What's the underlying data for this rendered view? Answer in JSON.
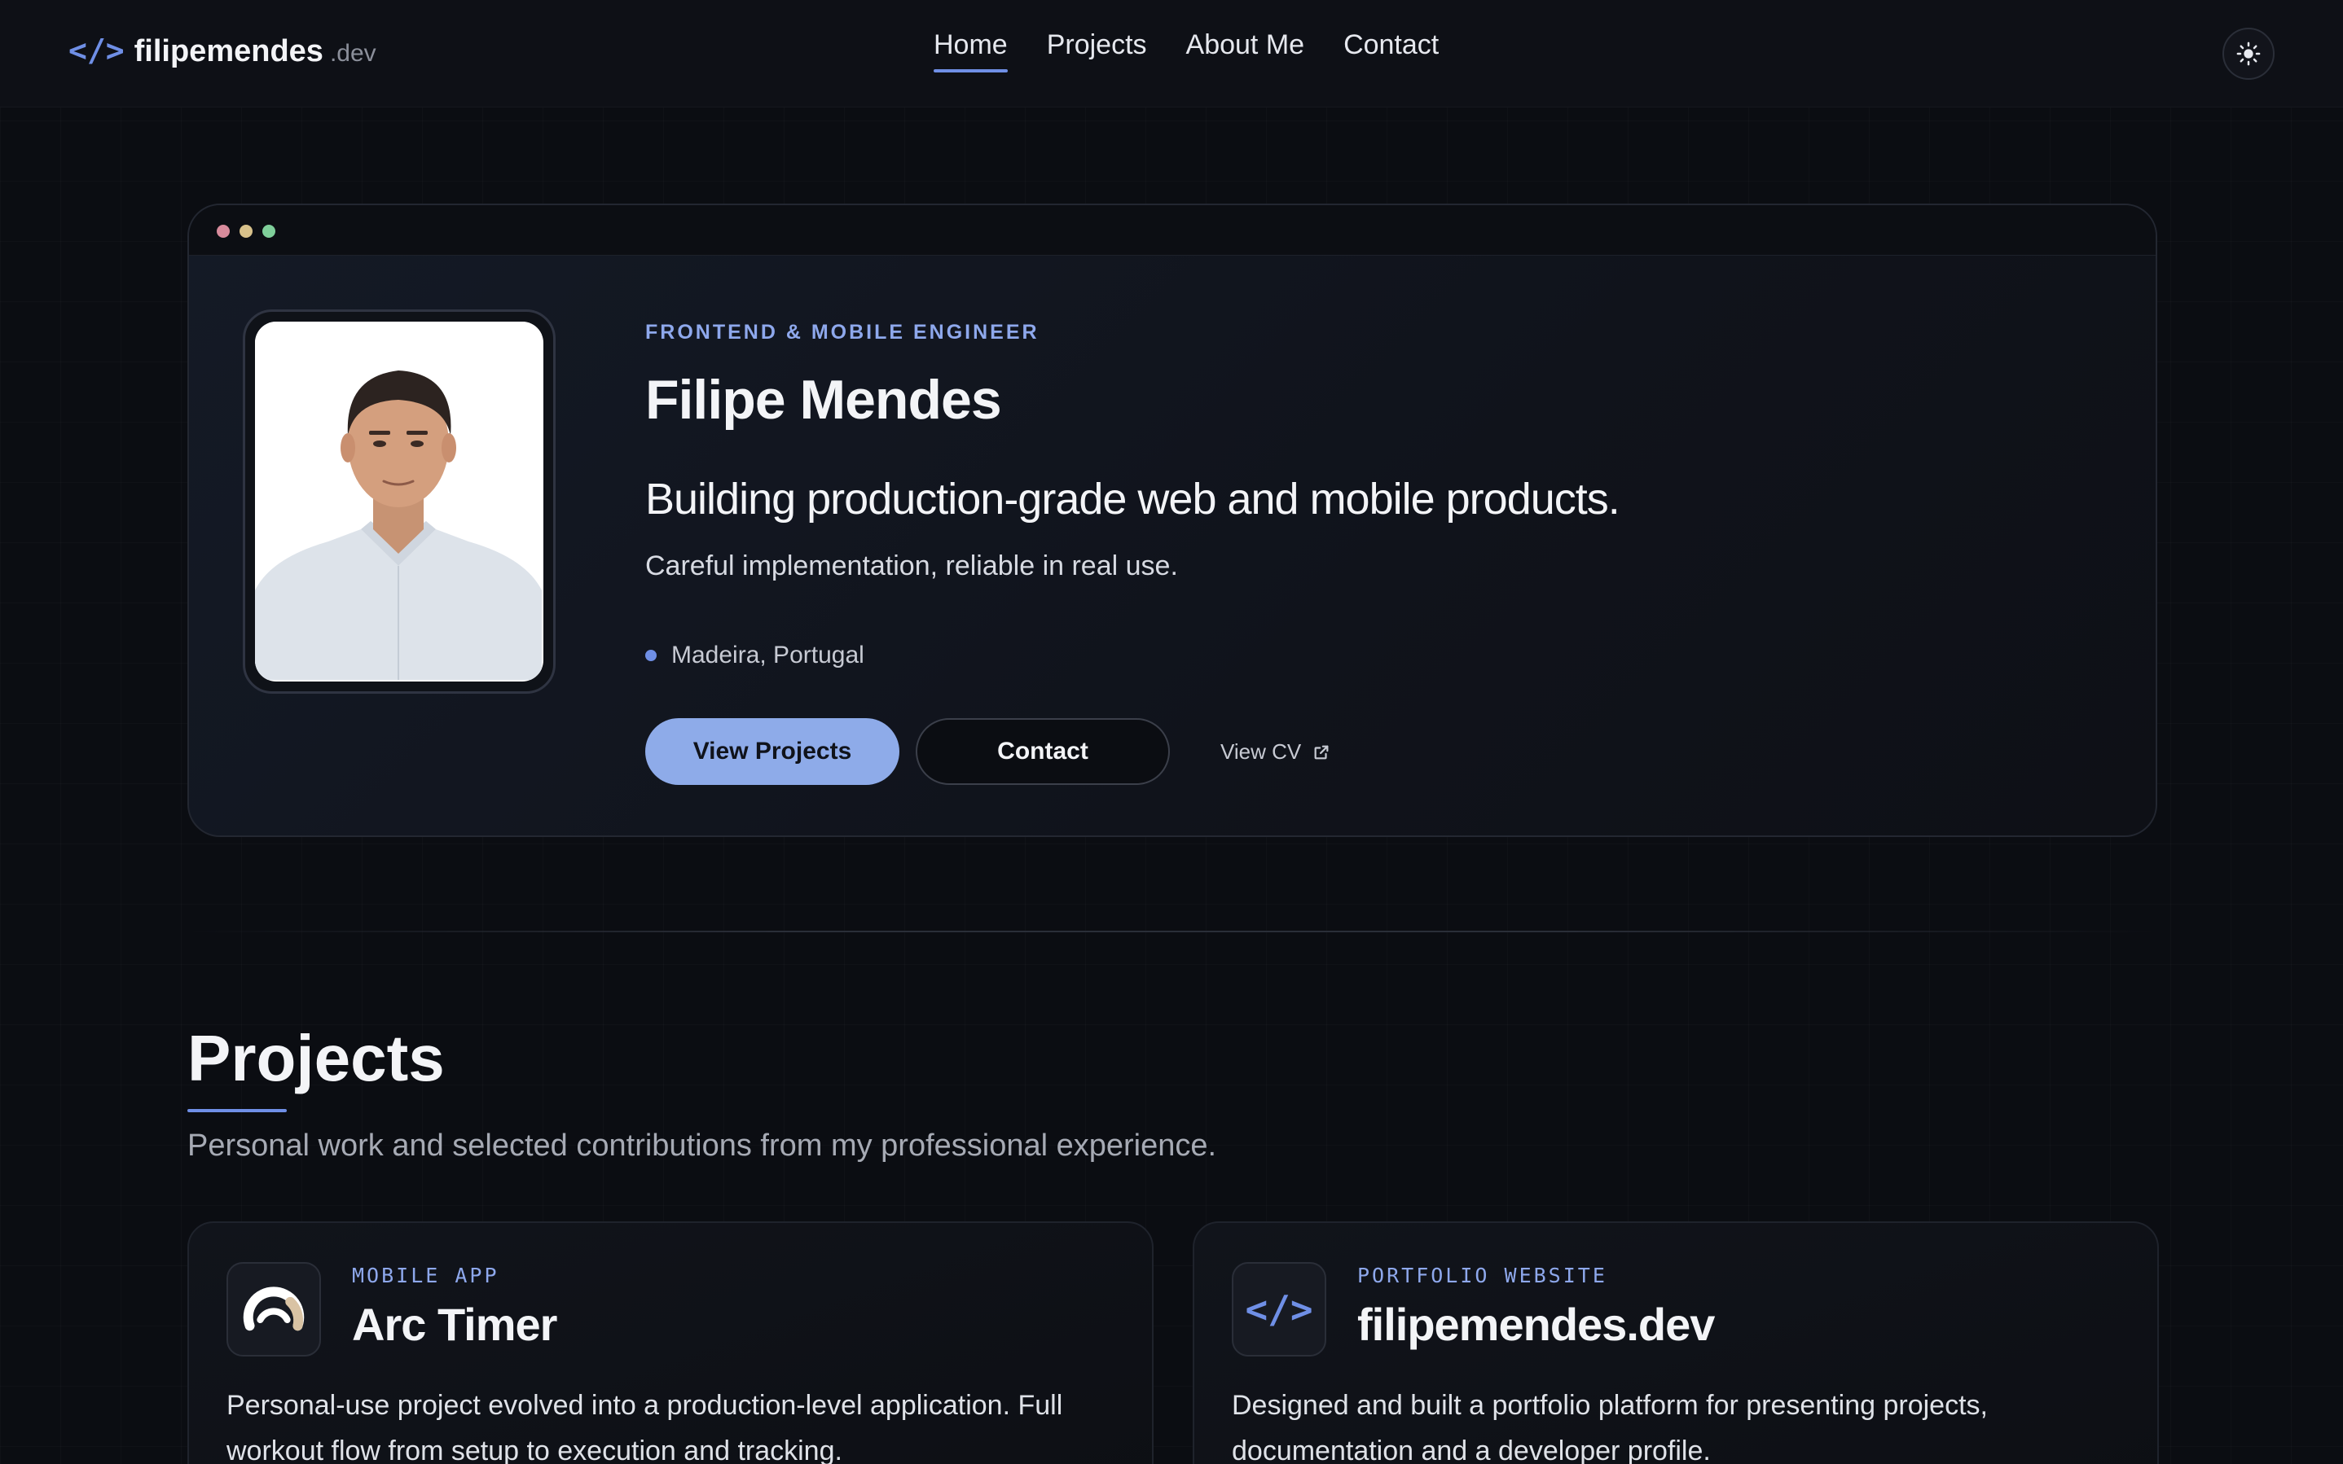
{
  "header": {
    "logo_icon": "</>",
    "logo_name": "filipemendes",
    "logo_tld": ".dev",
    "nav": [
      {
        "label": "Home",
        "active": true
      },
      {
        "label": "Projects",
        "active": false
      },
      {
        "label": "About Me",
        "active": false
      },
      {
        "label": "Contact",
        "active": false
      }
    ],
    "theme_icon": "sun-icon"
  },
  "hero": {
    "window_dots": [
      "#d88b9c",
      "#d8c18b",
      "#7fcf9a"
    ],
    "eyebrow": "FRONTEND & MOBILE ENGINEER",
    "name": "Filipe Mendes",
    "tagline": "Building production-grade web and mobile products.",
    "subline": "Careful implementation, reliable in real use.",
    "location": "Madeira, Portugal",
    "primary_button": "View Projects",
    "secondary_button": "Contact",
    "cv_link": "View CV"
  },
  "projects": {
    "title": "Projects",
    "subtitle": "Personal work and selected contributions from my professional experience.",
    "cards": [
      {
        "kind": "MOBILE APP",
        "title": "Arc Timer",
        "description": "Personal-use project evolved into a production-level application. Full workout flow from setup to execution and tracking.",
        "icon": "arc-timer-icon"
      },
      {
        "kind": "PORTFOLIO WEBSITE",
        "title": "filipemendes.dev",
        "description": "Designed and built a portfolio platform for presenting projects, documentation and a developer profile.",
        "icon": "code-brackets-icon",
        "icon_text": "</>"
      }
    ]
  },
  "colors": {
    "accent": "#6f8fe6",
    "accent_light": "#8eabe9",
    "background": "#0b0d12"
  }
}
